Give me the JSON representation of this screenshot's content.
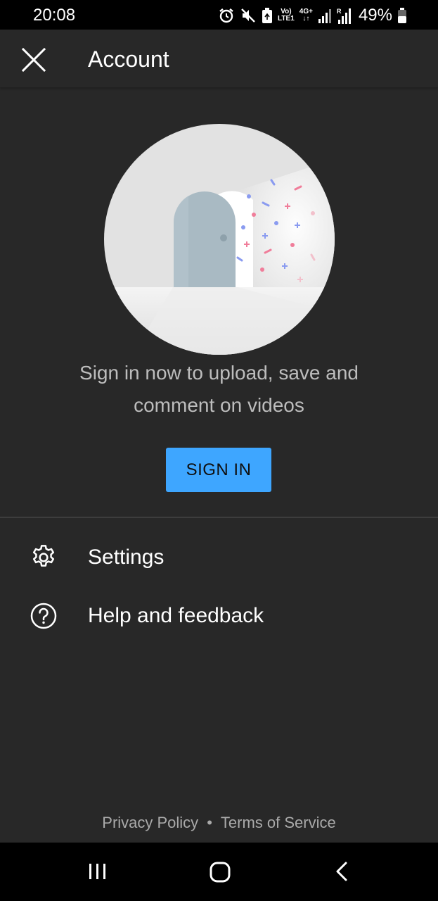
{
  "status_bar": {
    "time": "20:08",
    "volte_top": "Vo)",
    "volte_bottom": "LTE1",
    "network_top": "4G+",
    "battery": "49%",
    "icons": [
      "alarm-icon",
      "mute-icon",
      "battery-saver-icon",
      "volte-icon",
      "4g-plus-icon",
      "signal-icon",
      "roaming-signal-icon",
      "battery-icon"
    ]
  },
  "header": {
    "title": "Account",
    "close_icon": "close-icon"
  },
  "main": {
    "prompt_line1": "Sign in now to upload, save and",
    "prompt_line2": "comment on videos",
    "sign_in_label": "SIGN IN",
    "accent_color": "#3ea6ff"
  },
  "menu": {
    "items": [
      {
        "label": "Settings",
        "icon": "gear-icon"
      },
      {
        "label": "Help and feedback",
        "icon": "help-icon"
      }
    ]
  },
  "footer": {
    "privacy": "Privacy Policy",
    "separator": "•",
    "terms": "Terms of Service"
  },
  "nav": {
    "icons": [
      "recent-apps-icon",
      "home-icon",
      "back-icon"
    ]
  }
}
